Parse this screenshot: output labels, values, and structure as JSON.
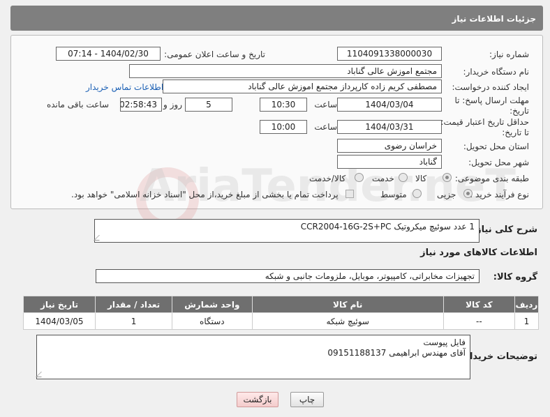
{
  "header": {
    "title": "جزئیات اطلاعات نیاز"
  },
  "form": {
    "need_number_label": "شماره نیاز:",
    "need_number": "1104091338000030",
    "announce_label": "تاریخ و ساعت اعلان عمومی:",
    "announce_value": "1404/02/30 - 07:14",
    "buyer_org_label": "نام دستگاه خریدار:",
    "buyer_org": "مجتمع اموزش عالی گناباد",
    "requester_label": "ایجاد کننده درخواست:",
    "requester": "مصطفی کریم زاده کارپرداز مجتمع اموزش عالی گناباد",
    "contact_link": "اطلاعات تماس خریدار",
    "deadline_label_1": "مهلت ارسال پاسخ: تا",
    "deadline_label_2": "تاریخ:",
    "deadline_date": "1404/03/04",
    "time_label": "ساعت",
    "deadline_time": "10:30",
    "days_value": "5",
    "days_label": "روز و",
    "remaining_time": "02:58:43",
    "remaining_label": "ساعت باقی مانده",
    "price_valid_label_1": "حداقل تاریخ اعتبار قیمت:",
    "price_valid_label_2": "تا تاریخ:",
    "price_valid_date": "1404/03/31",
    "price_valid_time": "10:00",
    "province_label": "استان محل تحویل:",
    "province": "خراسان رضوی",
    "city_label": "شهر محل تحویل:",
    "city": "گناباد",
    "category_label": "طبقه بندی موضوعی:",
    "category_options": [
      "کالا",
      "خدمت",
      "کالا/خدمت"
    ],
    "category_selected": "کالا",
    "process_label": "نوع فرآیند خرید :",
    "process_options": [
      "جزیی",
      "متوسط"
    ],
    "process_selected": "جزیی",
    "payment_note": "پرداخت تمام یا بخشی از مبلغ خرید،از محل \"اسناد خزانه اسلامی\" خواهد بود."
  },
  "description": {
    "label": "شرح کلی نیاز:",
    "text": "1 عدد سوئیچ میکروتیک    CCR2004-16G-2S+PC"
  },
  "goods_info_title": "اطلاعات کالاهای مورد نیاز",
  "goods_group": {
    "label": "گروه کالا:",
    "value": "تجهیزات مخابراتی، کامپیوتر، موبایل، ملزومات جانبی و شبکه"
  },
  "table": {
    "headers": [
      "ردیف",
      "کد کالا",
      "نام کالا",
      "واحد شمارش",
      "تعداد / مقدار",
      "تاریخ نیاز"
    ],
    "rows": [
      [
        "1",
        "--",
        "سوئیچ شبکه",
        "دستگاه",
        "1",
        "1404/03/05"
      ]
    ]
  },
  "buyer_notes": {
    "label": "توضیحات خریدار:",
    "line1": "فایل پیوست",
    "line2": "آقای مهندس ابراهیمی     09151188137"
  },
  "buttons": {
    "print": "چاپ",
    "back": "بازگشت"
  },
  "watermark": "AriaTender.neT"
}
